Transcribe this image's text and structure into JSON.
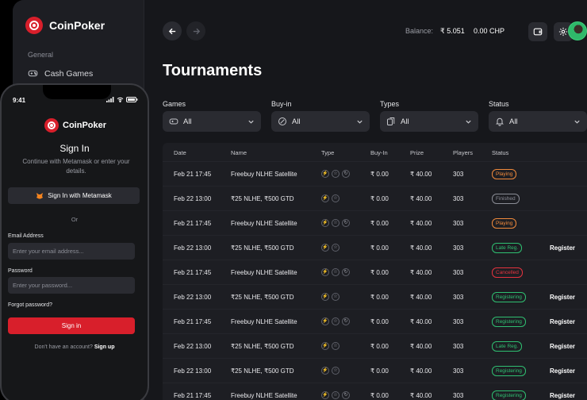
{
  "brand": {
    "name": "CoinPoker"
  },
  "sidebar": {
    "section": "General",
    "items": [
      {
        "label": "Cash Games",
        "icon": "gamepad-icon"
      }
    ]
  },
  "header": {
    "balance_label": "Balance:",
    "balance_value": "₹ 5.051",
    "chp_value": "0.00 CHP"
  },
  "page": {
    "title": "Tournaments"
  },
  "filters": [
    {
      "label": "Games",
      "value": "All",
      "icon": "gamepad-icon"
    },
    {
      "label": "Buy-in",
      "value": "All",
      "icon": "coin-icon"
    },
    {
      "label": "Types",
      "value": "All",
      "icon": "cards-icon"
    },
    {
      "label": "Status",
      "value": "All",
      "icon": "bell-icon"
    }
  ],
  "table": {
    "columns": [
      "Date",
      "Name",
      "Type",
      "Buy-In",
      "Prize",
      "Players",
      "Status"
    ],
    "rows": [
      {
        "date": "Feb 21 17:45",
        "name": "Freebuy NLHE Satellite",
        "buyin": "₹ 0.00",
        "prize": "₹ 40.00",
        "players": "303",
        "status": "Playing",
        "action": "",
        "types": 3
      },
      {
        "date": "Feb 22 13:00",
        "name": "₹25 NLHE, ₹500 GTD",
        "buyin": "₹ 0.00",
        "prize": "₹ 40.00",
        "players": "303",
        "status": "Finished",
        "action": "",
        "types": 2
      },
      {
        "date": "Feb 21 17:45",
        "name": "Freebuy NLHE Satellite",
        "buyin": "₹ 0.00",
        "prize": "₹ 40.00",
        "players": "303",
        "status": "Playing",
        "action": "",
        "types": 3
      },
      {
        "date": "Feb 22 13:00",
        "name": "₹25 NLHE, ₹500 GTD",
        "buyin": "₹ 0.00",
        "prize": "₹ 40.00",
        "players": "303",
        "status": "Late Reg.",
        "action": "Register",
        "types": 2
      },
      {
        "date": "Feb 21 17:45",
        "name": "Freebuy NLHE Satellite",
        "buyin": "₹ 0.00",
        "prize": "₹ 40.00",
        "players": "303",
        "status": "Cancelled",
        "action": "",
        "types": 3
      },
      {
        "date": "Feb 22 13:00",
        "name": "₹25 NLHE, ₹500 GTD",
        "buyin": "₹ 0.00",
        "prize": "₹ 40.00",
        "players": "303",
        "status": "Registering",
        "action": "Register",
        "types": 2
      },
      {
        "date": "Feb 21 17:45",
        "name": "Freebuy NLHE Satellite",
        "buyin": "₹ 0.00",
        "prize": "₹ 40.00",
        "players": "303",
        "status": "Registering",
        "action": "Register",
        "types": 3
      },
      {
        "date": "Feb 22 13:00",
        "name": "₹25 NLHE, ₹500 GTD",
        "buyin": "₹ 0.00",
        "prize": "₹ 40.00",
        "players": "303",
        "status": "Late Reg.",
        "action": "Register",
        "types": 2
      },
      {
        "date": "Feb 22 13:00",
        "name": "₹25 NLHE, ₹500 GTD",
        "buyin": "₹ 0.00",
        "prize": "₹ 40.00",
        "players": "303",
        "status": "Registering",
        "action": "Register",
        "types": 2
      },
      {
        "date": "Feb 21 17:45",
        "name": "Freebuy NLHE Satellite",
        "buyin": "₹ 0.00",
        "prize": "₹ 40.00",
        "players": "303",
        "status": "Registering",
        "action": "Register",
        "types": 3
      }
    ]
  },
  "status_colors": {
    "Playing": "#f08a3c",
    "Finished": "#8b8d96",
    "Late Reg.": "#2fbf71",
    "Cancelled": "#e5333f",
    "Registering": "#2fbf71"
  },
  "phone": {
    "time": "9:41",
    "brand": "CoinPoker",
    "title": "Sign In",
    "subtitle": "Continue with Metamask or enter your details.",
    "metamask_button": "Sign In with Metamask",
    "or": "Or",
    "email_label": "Email Address",
    "email_placeholder": "Enter your email address...",
    "password_label": "Password",
    "password_placeholder": "Enter your password...",
    "forgot": "Forgot password?",
    "signin_button": "Sign in",
    "no_account": "Don't have an account?",
    "signup": "Sign up"
  },
  "colors": {
    "accent": "#d81f2b",
    "background": "#16171b",
    "panel": "#1d1e23"
  }
}
